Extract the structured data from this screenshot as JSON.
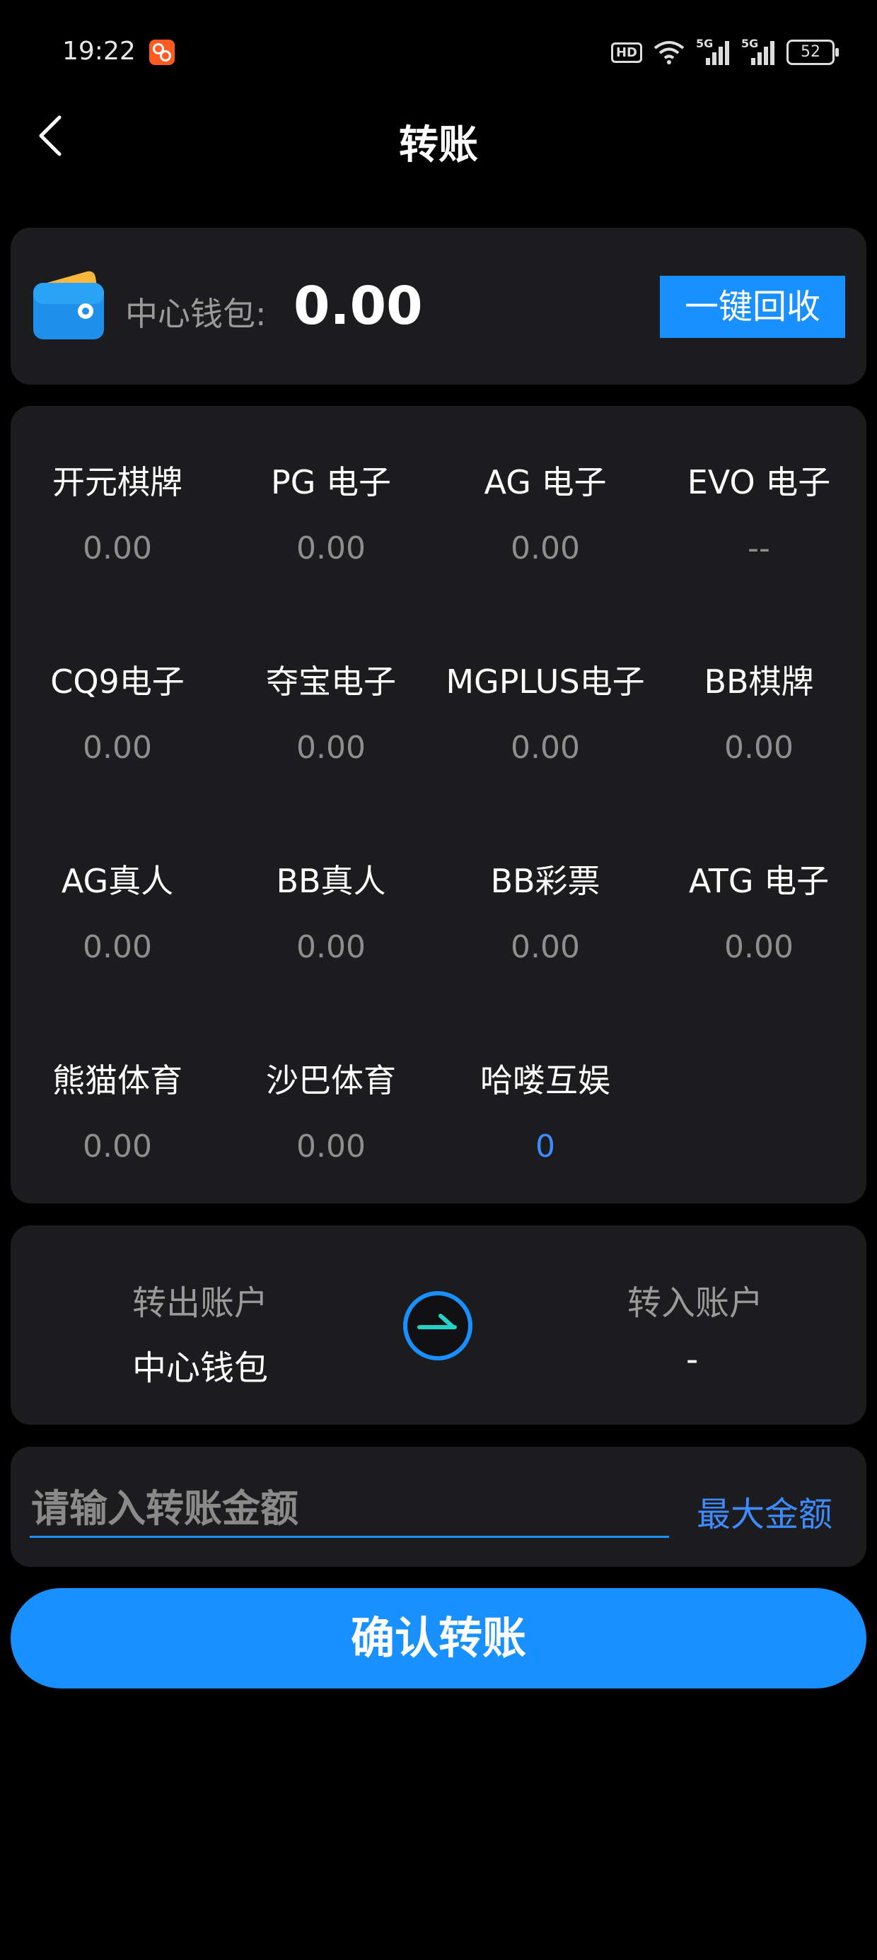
{
  "status_bar": {
    "time": "19:22",
    "hd": "HD",
    "net1": "5G",
    "net2": "5G",
    "battery": "52"
  },
  "header": {
    "title": "转账"
  },
  "wallet": {
    "label": "中心钱包:",
    "balance": "0.00",
    "recycle_label": "一键回收"
  },
  "platforms": [
    {
      "name": "开元棋牌",
      "balance": "0.00"
    },
    {
      "name": "PG 电子",
      "balance": "0.00"
    },
    {
      "name": "AG 电子",
      "balance": "0.00"
    },
    {
      "name": "EVO 电子",
      "balance": "--"
    },
    {
      "name": "CQ9电子",
      "balance": "0.00"
    },
    {
      "name": "夺宝电子",
      "balance": "0.00"
    },
    {
      "name": "MGPLUS电子",
      "balance": "0.00"
    },
    {
      "name": "BB棋牌",
      "balance": "0.00"
    },
    {
      "name": "AG真人",
      "balance": "0.00"
    },
    {
      "name": "BB真人",
      "balance": "0.00"
    },
    {
      "name": "BB彩票",
      "balance": "0.00"
    },
    {
      "name": "ATG 电子",
      "balance": "0.00"
    },
    {
      "name": "熊猫体育",
      "balance": "0.00"
    },
    {
      "name": "沙巴体育",
      "balance": "0.00"
    },
    {
      "name": "哈喽互娱",
      "balance": "0"
    }
  ],
  "transfer": {
    "out_label": "转出账户",
    "out_value": "中心钱包",
    "in_label": "转入账户",
    "in_value": "-"
  },
  "amount": {
    "placeholder": "请输入转账金额",
    "max_label": "最大金额"
  },
  "confirm_label": "确认转账",
  "colors": {
    "accent": "#1890ff",
    "card": "#1c1c1e",
    "background": "#000000",
    "highlight_balance": "#3d8bff"
  }
}
